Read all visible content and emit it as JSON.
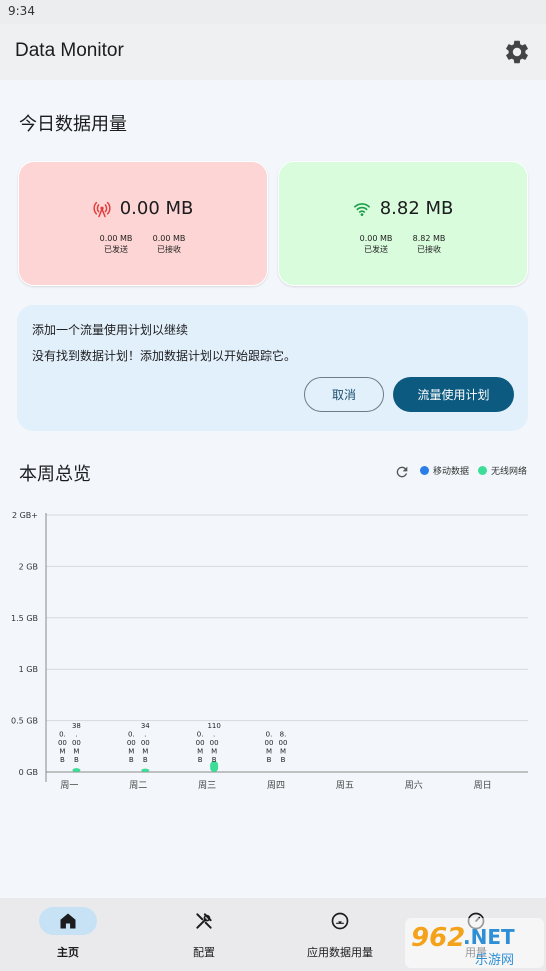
{
  "status_bar": {
    "time": "9:34"
  },
  "app_bar": {
    "title": "Data Monitor",
    "settings_icon": "gear-icon"
  },
  "today": {
    "title": "今日数据用量",
    "mobile": {
      "icon": "cell-tower-icon",
      "total": "0.00 MB",
      "sent_value": "0.00 MB",
      "sent_label": "已发送",
      "received_value": "0.00 MB",
      "received_label": "已接收",
      "color": "#fdd5d5"
    },
    "wifi": {
      "icon": "wifi-icon",
      "total": "8.82 MB",
      "sent_value": "0.00 MB",
      "sent_label": "已发送",
      "received_value": "8.82 MB",
      "received_label": "已接收",
      "color": "#d9fcdc"
    }
  },
  "plan_prompt": {
    "title": "添加一个流量使用计划以继续",
    "description": "没有找到数据计划！添加数据计划以开始跟踪它。",
    "cancel_label": "取消",
    "plan_label": "流量使用计划"
  },
  "weekly": {
    "title": "本周总览",
    "refresh_icon": "refresh-icon",
    "legend": [
      {
        "label": "移动数据",
        "color": "#2b7de9"
      },
      {
        "label": "无线网络",
        "color": "#3ddc97"
      }
    ]
  },
  "chart_data": {
    "type": "bar",
    "categories": [
      "周一",
      "周二",
      "周三",
      "周四",
      "周五",
      "周六",
      "周日"
    ],
    "series": [
      {
        "name": "移动数据",
        "values": [
          0.0,
          0.0,
          0.0,
          0.0,
          null,
          null,
          null
        ],
        "labels": [
          "0.00MB",
          "0.00MB",
          "0.00MB",
          "0.00MB",
          "",
          "",
          ""
        ]
      },
      {
        "name": "无线网络",
        "values": [
          0.0371,
          0.0332,
          0.1074,
          0.0086,
          null,
          null,
          null
        ],
        "labels": [
          "38.00MB",
          "34.00MB",
          "110.00MB",
          "8.00MB",
          "",
          "",
          ""
        ]
      }
    ],
    "y_ticks": [
      "0 GB",
      "0.5 GB",
      "1 GB",
      "1.5 GB",
      "2 GB",
      "2 GB+"
    ],
    "ylim": [
      0,
      2.5
    ],
    "grid": true
  },
  "bottom_nav": [
    {
      "label": "主页",
      "icon": "home-icon",
      "active": true
    },
    {
      "label": "配置",
      "icon": "tools-icon",
      "active": false
    },
    {
      "label": "应用数据用量",
      "icon": "app-usage-icon",
      "active": false
    },
    {
      "label": "用量",
      "icon": "usage-icon",
      "active": false
    }
  ],
  "watermark": {
    "text_main": "962",
    "text_net": ".NET",
    "text_sub": "乐游网"
  }
}
